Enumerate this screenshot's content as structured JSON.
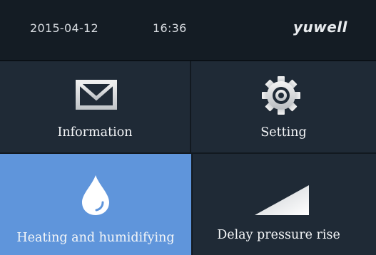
{
  "status_bar": {
    "date": "2015-04-12",
    "time": "16:36",
    "brand": "yuwell"
  },
  "tiles": [
    {
      "label": "Information",
      "icon": "envelope-icon",
      "selected": false
    },
    {
      "label": "Setting",
      "icon": "gear-icon",
      "selected": false
    },
    {
      "label": "Heating and humidifying",
      "icon": "water-drop-icon",
      "selected": true
    },
    {
      "label": "Delay pressure rise",
      "icon": "ramp-icon",
      "selected": false
    }
  ],
  "colors": {
    "status_bar_bg": "#141c24",
    "tile_bg": "#1f2a36",
    "selected_tile_bg": "#5f95db",
    "text": "#f4f6f8"
  }
}
